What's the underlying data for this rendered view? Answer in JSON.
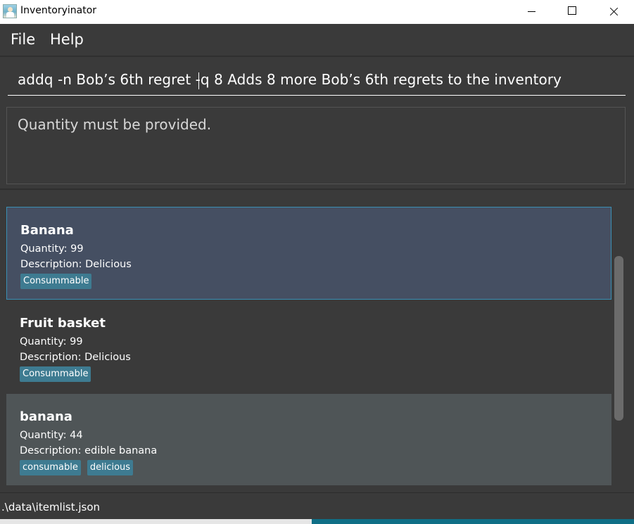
{
  "window": {
    "title": "Inventoryinator"
  },
  "menu": {
    "file": "File",
    "help": "Help"
  },
  "command": {
    "value": "addq -n Bob’s 6th regret -q 8 Adds 8 more Bob’s 6th regrets to the inventory"
  },
  "result": {
    "text": "Quantity must be provided."
  },
  "items": [
    {
      "name": "Banana",
      "quantity": "Quantity: 99",
      "description": "Description: Delicious",
      "tags": [
        "Consummable"
      ]
    },
    {
      "name": "Fruit basket",
      "quantity": "Quantity: 99",
      "description": "Description: Delicious",
      "tags": [
        "Consummable"
      ]
    },
    {
      "name": "banana",
      "quantity": "Quantity: 44",
      "description": "Description: edible banana",
      "tags": [
        "consumable",
        "delicious"
      ]
    }
  ],
  "status": {
    "path": ".\\data\\itemlist.json"
  },
  "colors": {
    "background": "#3a3a3a",
    "selected": "#454f62",
    "tag": "#3e7b91",
    "accent": "#0f6f86"
  }
}
